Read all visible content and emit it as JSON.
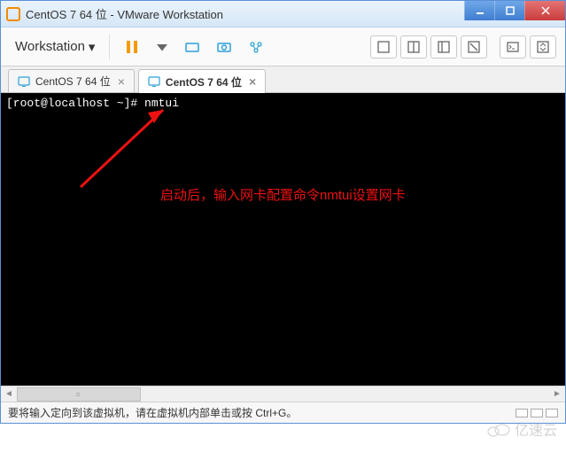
{
  "window": {
    "title": "CentOS 7 64 位 - VMware Workstation",
    "min_label": "–",
    "max_label": "□",
    "close_label": "✕"
  },
  "toolbar": {
    "workstation_label": "Workstation",
    "chevron": "▾"
  },
  "tabs": [
    {
      "label": "CentOS 7 64 位",
      "active": false
    },
    {
      "label": "CentOS 7 64 位",
      "active": true
    }
  ],
  "terminal": {
    "prompt": "[root@localhost ~]# ",
    "command": "nmtui",
    "annotation_text": "启动后，输入网卡配置命令nmtui设置网卡"
  },
  "statusbar": {
    "message": "要将输入定向到该虚拟机，请在虚拟机内部单击或按 Ctrl+G。"
  },
  "watermark": {
    "text": "亿速云"
  }
}
